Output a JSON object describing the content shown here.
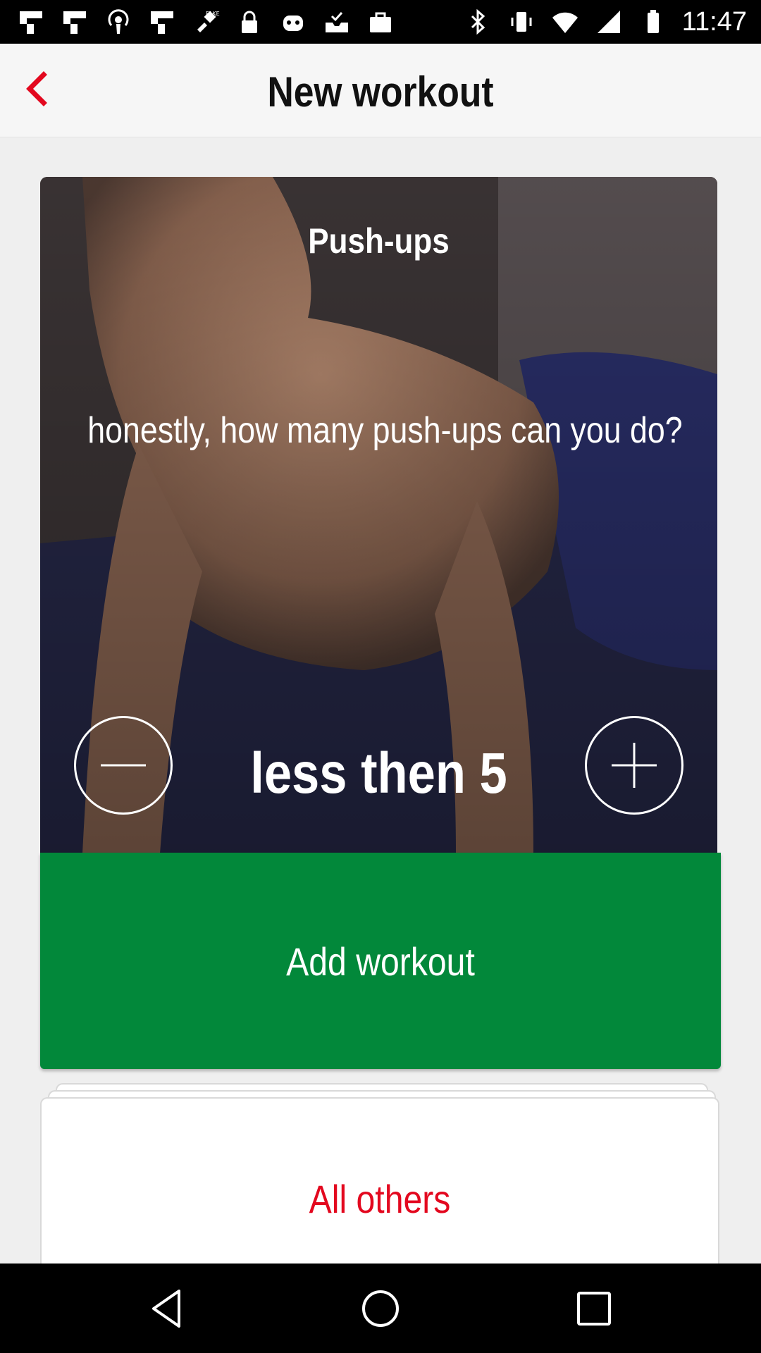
{
  "status_bar": {
    "time": "11:47",
    "left_icons": [
      "flipboard-icon",
      "flipboard-icon",
      "podcast-icon",
      "flipboard-icon",
      "fake-gps-icon",
      "lock-icon",
      "game-controller-icon",
      "inbox-check-icon",
      "briefcase-icon"
    ],
    "right_icons": [
      "bluetooth-icon",
      "vibrate-icon",
      "wifi-icon",
      "signal-icon",
      "battery-icon"
    ]
  },
  "app_bar": {
    "title": "New workout",
    "back_icon": "chevron-left-icon",
    "accent_color": "#e3081f"
  },
  "workout": {
    "exercise": "Push-ups",
    "question": "honestly, how many push-ups can you do?",
    "count_label": "less then 5",
    "decrease_icon": "minus-icon",
    "increase_icon": "plus-icon"
  },
  "actions": {
    "add_workout": "Add workout",
    "add_workout_color": "#02883a",
    "all_others": "All others",
    "all_others_color": "#e3081f"
  },
  "nav_bar": {
    "icons": [
      "back-triangle-icon",
      "home-circle-icon",
      "recents-square-icon"
    ]
  }
}
